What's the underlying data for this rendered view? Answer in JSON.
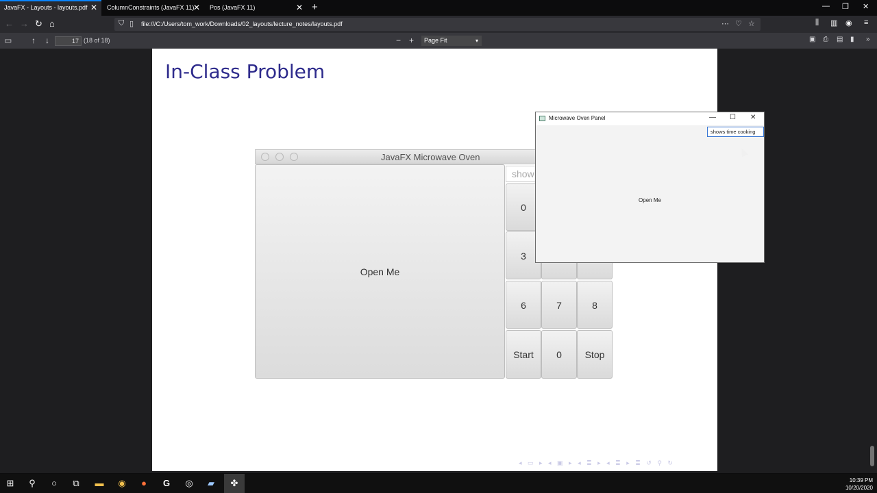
{
  "browser": {
    "tabs": [
      {
        "label": "JavaFX - Layouts - layouts.pdf",
        "active": true
      },
      {
        "label": "ColumnConstraints (JavaFX 11)",
        "active": false
      },
      {
        "label": "Pos (JavaFX 11)",
        "active": false
      }
    ],
    "url": "file:///C:/Users/tom_work/Downloads/02_layouts/lecture_notes/layouts.pdf",
    "accent": "#0a84ff"
  },
  "pdf_toolbar": {
    "page_number": "17",
    "page_count": "(18 of 18)",
    "zoom": "Page Fit"
  },
  "slide": {
    "title": "In-Class Problem",
    "title_color": "#2e2b8c",
    "fx_window": {
      "title": "JavaFX Microwave Oven",
      "open_button": "Open Me",
      "display_placeholder": "show",
      "keys": [
        "0",
        "3",
        "6",
        "7",
        "8",
        "Start",
        "0",
        "Stop"
      ]
    }
  },
  "overlay_window": {
    "title": "Microwave Oven Panel",
    "display_value": "shows time cooking",
    "open_button": "Open Me"
  },
  "taskbar": {
    "time": "10:39 PM",
    "date": "10/20/2020"
  }
}
